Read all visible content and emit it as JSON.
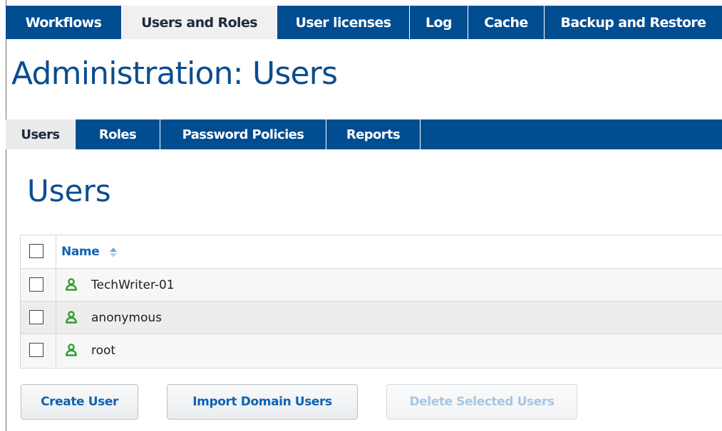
{
  "top_tabs": [
    {
      "label": "Workflows",
      "active": false
    },
    {
      "label": "Users and Roles",
      "active": true
    },
    {
      "label": "User licenses",
      "active": false
    },
    {
      "label": "Log",
      "active": false
    },
    {
      "label": "Cache",
      "active": false
    },
    {
      "label": "Backup and Restore",
      "active": false
    }
  ],
  "page_title": "Administration: Users",
  "sub_tabs": [
    {
      "label": "Users",
      "active": true
    },
    {
      "label": "Roles",
      "active": false
    },
    {
      "label": "Password Policies",
      "active": false
    },
    {
      "label": "Reports",
      "active": false
    }
  ],
  "section_title": "Users",
  "grid": {
    "column_header": "Name",
    "sort": "ascending",
    "rows": [
      {
        "name": "TechWriter-01",
        "icon": "user-icon",
        "checked": false
      },
      {
        "name": "anonymous",
        "icon": "user-icon",
        "checked": false
      },
      {
        "name": "root",
        "icon": "user-icon",
        "checked": false
      }
    ]
  },
  "buttons": {
    "create_user": "Create User",
    "import_domain_users": "Import Domain Users",
    "delete_selected_users": "Delete Selected Users"
  },
  "colors": {
    "nav_bar": "#004d91",
    "title": "#0b4d8f",
    "link": "#0f63b4",
    "user_icon": "#2e9e2e",
    "sort_icon": "#6fa8dc"
  }
}
